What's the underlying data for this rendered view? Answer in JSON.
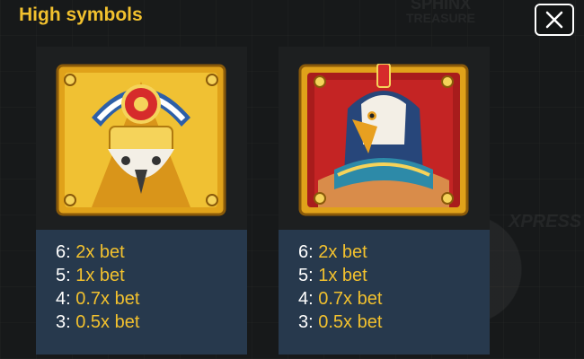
{
  "header": {
    "title": "High symbols"
  },
  "background": {
    "logo_line1": "SPHINX",
    "logo_line2": "TREASURE",
    "xpress": "XPRESS"
  },
  "cards": [
    {
      "symbol_icon": "golden-horus-falcon-icon",
      "payouts": [
        {
          "count": "6:",
          "value": "2x bet"
        },
        {
          "count": "5:",
          "value": "1x bet"
        },
        {
          "count": "4:",
          "value": "0.7x bet"
        },
        {
          "count": "3:",
          "value": "0.5x bet"
        }
      ]
    },
    {
      "symbol_icon": "red-falcon-god-icon",
      "payouts": [
        {
          "count": "6:",
          "value": "2x bet"
        },
        {
          "count": "5:",
          "value": "1x bet"
        },
        {
          "count": "4:",
          "value": "0.7x bet"
        },
        {
          "count": "3:",
          "value": "0.5x bet"
        }
      ]
    }
  ],
  "colors": {
    "accent": "#f2c12e",
    "panel": "#27394d",
    "background": "#17191a"
  }
}
